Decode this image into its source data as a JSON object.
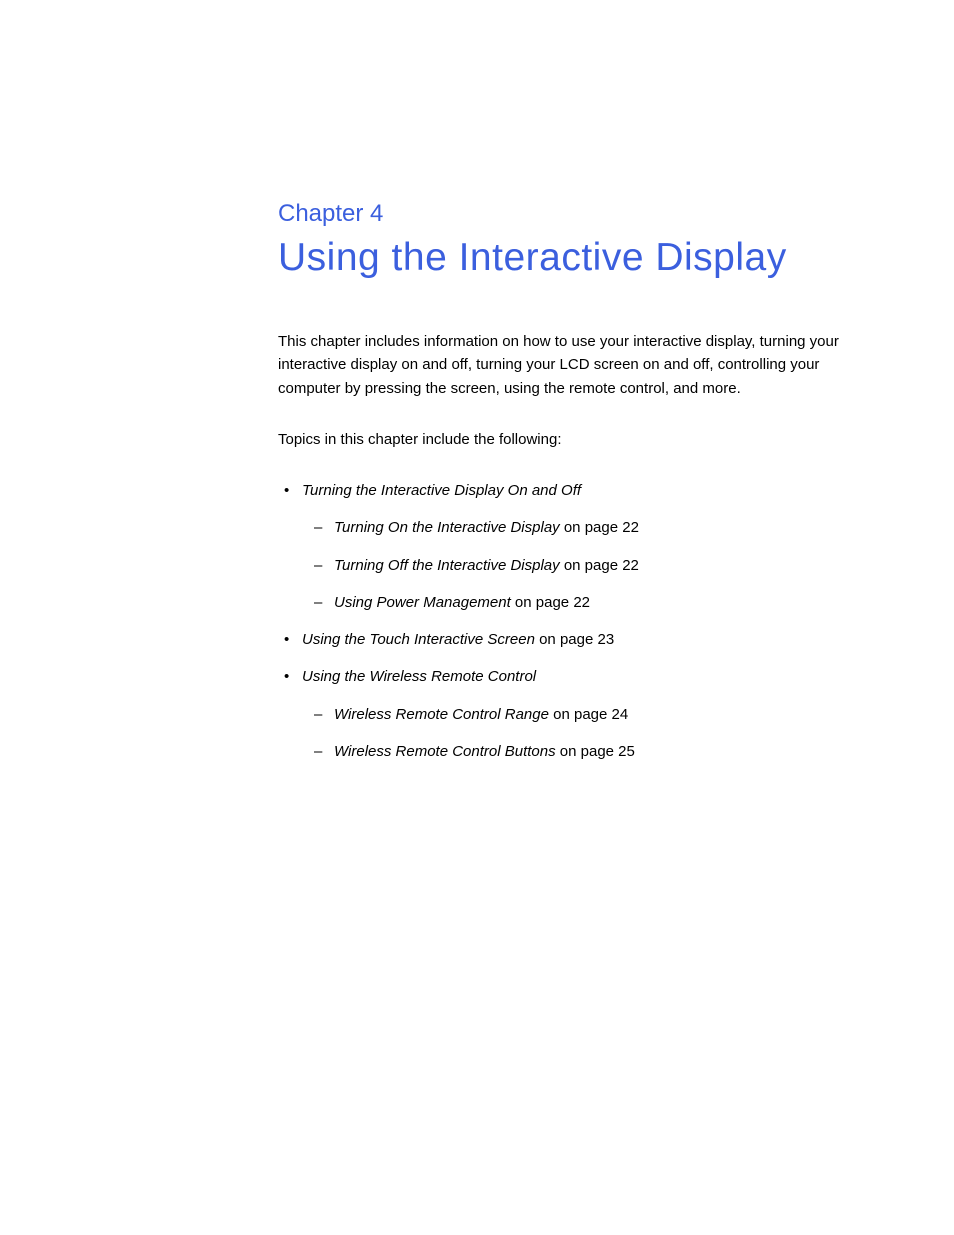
{
  "chapter": {
    "label": "Chapter 4",
    "title": "Using the Interactive Display"
  },
  "intro": "This chapter includes information on how to use your interactive display, turning your interactive display on and off, turning your LCD screen on and off, controlling your computer by pressing the screen, using the remote control, and more.",
  "topics_intro": "Topics in this chapter include the following:",
  "toc": [
    {
      "title": "Turning the Interactive Display On and Off",
      "page_ref": "",
      "subitems": [
        {
          "title": "Turning On the Interactive Display",
          "page_ref": " on page 22"
        },
        {
          "title": "Turning Off the Interactive Display",
          "page_ref": " on page 22"
        },
        {
          "title": "Using Power Management",
          "page_ref": " on page 22"
        }
      ]
    },
    {
      "title": "Using the Touch Interactive Screen",
      "page_ref": " on page 23",
      "subitems": []
    },
    {
      "title": "Using the Wireless Remote Control",
      "page_ref": "",
      "subitems": [
        {
          "title": "Wireless Remote Control Range",
          "page_ref": " on page 24"
        },
        {
          "title": "Wireless Remote Control Buttons",
          "page_ref": " on page 25"
        }
      ]
    }
  ]
}
